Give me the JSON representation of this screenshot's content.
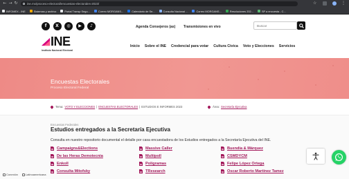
{
  "browser": {
    "nav_icons": [
      "back-icon",
      "forward-icon",
      "reload-icon"
    ],
    "url": "ine.mx/proceso-electoral/encuestas-electorales-2023/",
    "bookmarks": [
      "INFOMEX - INE",
      "Sistemas y archivo",
      "Portal Transp Segu...",
      "Correo MORGANS...",
      "Calendario de Se...",
      "Consulta Nacional ...",
      "Correo MORGANS...",
      "Resoluciones 202...",
      "SP a encuesta - C..."
    ],
    "toolbar_icons": [
      "star-icon",
      "extension-icon",
      "profile-icon",
      "menu-icon"
    ]
  },
  "topbar": {
    "social_icons": [
      "facebook-icon",
      "x-icon",
      "instagram-icon",
      "youtube-icon",
      "tiktok-icon"
    ],
    "agenda_link": "Agenda Consejeros (as)",
    "live_link": "Transmisiones en vivo",
    "search_placeholder": "Buscar"
  },
  "brand": {
    "logo_text": "INE",
    "logo_subtitle": "Instituto Nacional Electoral",
    "accent_color": "#d5007f"
  },
  "nav": {
    "items": [
      "Inicio",
      "Sobre el INE",
      "Credencial para votar",
      "Cultura Cívica",
      "Voto y Elecciones",
      "Servicios"
    ]
  },
  "hero": {
    "title": "Encuestas Electorales",
    "subtitle": "Proceso Electoral Federal",
    "bg_color": "#ef8e8a"
  },
  "breadcrumb": {
    "tema_label": "Tema:",
    "items": [
      "VOTO Y ELECCIONES",
      "ENCUESTAS ELECTORALES",
      "ESTUDIOS E INFORMES 2023"
    ],
    "separator": "|",
    "area_label": "Área:",
    "area_value": "Secretaría Ejecutiva"
  },
  "content": {
    "eyebrow": "Encuestas Federales",
    "heading": "Estudios entregados a la Secretaría Ejecutiva",
    "intro": "Consulta en nuestro repositorio documental el detalle por casa encuestadora de los Estudios entregados a la Secretaría Ejecutiva del INE.",
    "link_color": "#a3195b",
    "columns": [
      [
        "Campaigns&Elections",
        "De las Heras Demotecnia",
        "Enkoll",
        "Consulta Mitofsky"
      ],
      [
        "Massive Caller",
        "Multipoll",
        "Poligramas",
        "TResearch"
      ],
      [
        "Buendía & Márquez",
        "CSMDYCM",
        "Felipe López Ortega",
        "Oscar Roberto Martínez Tamez"
      ]
    ]
  },
  "widgets": {
    "accessibility_icon": "accessibility-icon",
    "whatsapp_icon": "whatsapp-icon",
    "whatsapp_color": "#25d366"
  },
  "footer_bar": {
    "items": [
      "Conexión",
      "Latinoamericana"
    ]
  }
}
